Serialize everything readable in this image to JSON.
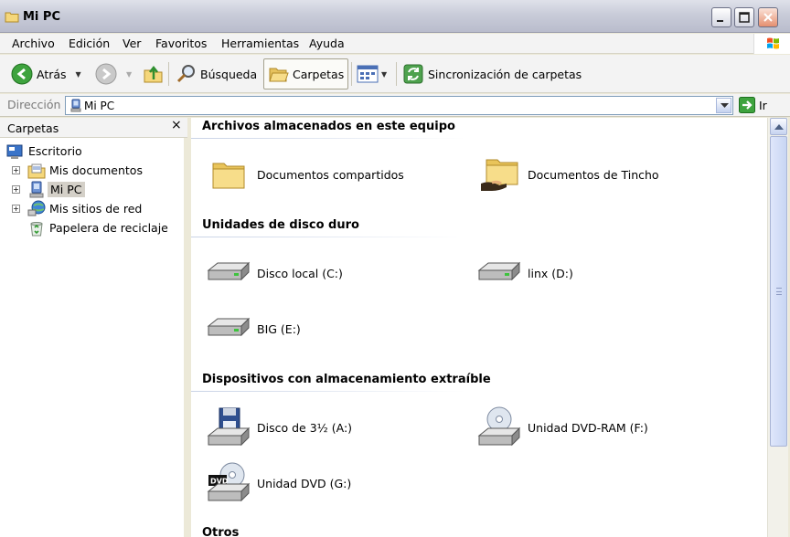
{
  "window": {
    "title": "Mi PC"
  },
  "menu": [
    "Archivo",
    "Edición",
    "Ver",
    "Favoritos",
    "Herramientas",
    "Ayuda"
  ],
  "toolbar": {
    "back": "Atrás",
    "search": "Búsqueda",
    "folders": "Carpetas",
    "sync": "Sincronización de carpetas"
  },
  "address": {
    "label": "Dirección",
    "value": "Mi PC",
    "go": "Ir"
  },
  "left_pane": {
    "title": "Carpetas",
    "close": "×",
    "items": [
      "Escritorio",
      "Mis documentos",
      "Mi PC",
      "Mis sitios de red",
      "Papelera de reciclaje"
    ]
  },
  "groups": {
    "files": {
      "title": "Archivos almacenados en este equipo",
      "items": [
        "Documentos compartidos",
        "Documentos de Tincho"
      ]
    },
    "drives": {
      "title": "Unidades de disco duro",
      "items": [
        "Disco local (C:)",
        "linx (D:)",
        "BIG (E:)"
      ]
    },
    "removable": {
      "title": "Dispositivos con almacenamiento extraíble",
      "items": [
        "Disco de 3½ (A:)",
        "Unidad DVD-RAM (F:)",
        "Unidad DVD (G:)"
      ]
    },
    "other": {
      "title": "Otros"
    }
  },
  "colors": {
    "accent": "#316ac5",
    "selection": "#d4d0c8",
    "folder": "#f5d77b"
  }
}
